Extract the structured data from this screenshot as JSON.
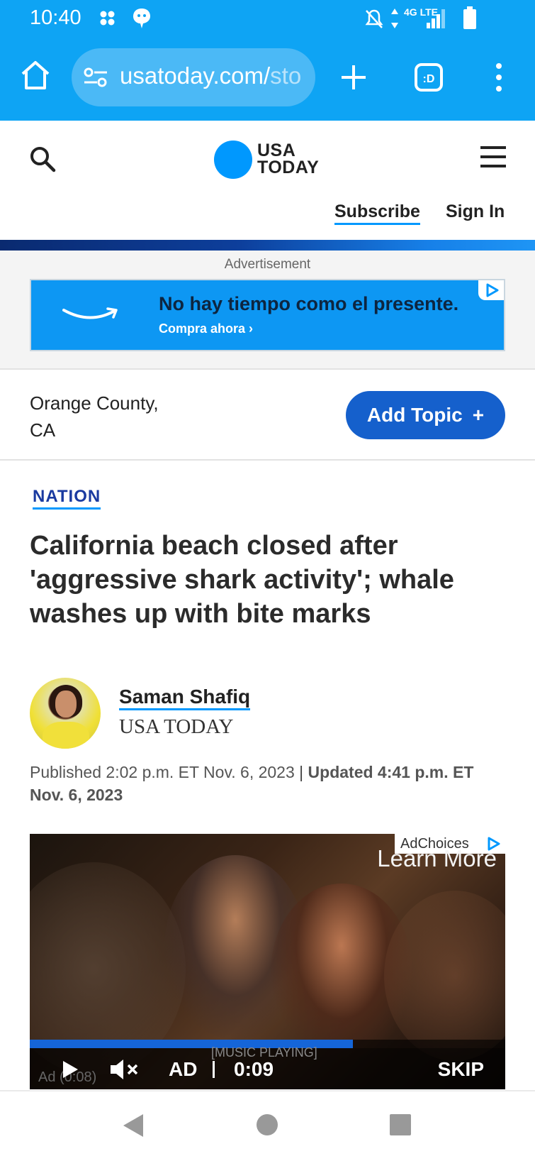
{
  "status_bar": {
    "time": "10:40",
    "network": "4G LTE"
  },
  "browser": {
    "url_visible": "usatoday.com/",
    "url_faded": "sto"
  },
  "site": {
    "logo_line1": "USA",
    "logo_line2": "TODAY",
    "subscribe": "Subscribe",
    "sign_in": "Sign In"
  },
  "ad": {
    "label": "Advertisement",
    "headline": "No hay tiempo como el presente.",
    "cta": "Compra ahora ›"
  },
  "topic": {
    "location": "Orange County, CA",
    "add_topic": "Add Topic",
    "add_icon": "+"
  },
  "article": {
    "category": "NATION",
    "headline": "California beach closed after 'aggressive shark activity'; whale washes up with bite marks",
    "author": "Saman Shafiq",
    "outlet": "USA TODAY",
    "published": "Published 2:02 p.m. ET Nov. 6, 2023",
    "updated": "Updated 4:41 p.m. ET Nov. 6, 2023"
  },
  "video": {
    "ad_choices": "AdChoices",
    "learn_more": "Learn More",
    "ad_label": "AD",
    "time": "0:09",
    "skip": "SKIP",
    "caption": "[MUSIC PLAYING]",
    "ad_remaining": "Ad (0:08)",
    "progress": 0.68
  },
  "colors": {
    "chrome": "#0ea4f4",
    "brand_blue": "#0098fe",
    "button_blue": "#1560cc",
    "category": "#1a3aa0"
  }
}
